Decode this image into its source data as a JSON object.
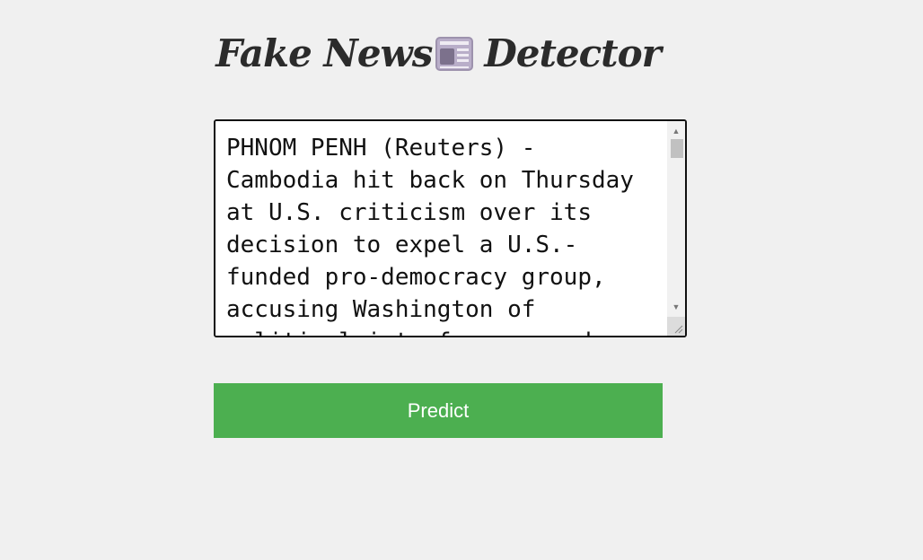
{
  "header": {
    "title_part1": "Fake News",
    "title_icon": "newspaper-icon",
    "title_part2": "Detector"
  },
  "news_input": {
    "value": "PHNOM PENH (Reuters) - Cambodia hit back on Thursday at U.S. criticism over its decision to expel a U.S.-funded pro-democracy group, accusing Washington of political interference and"
  },
  "predict_button": {
    "label": "Predict"
  },
  "colors": {
    "background": "#f0f0f0",
    "title": "#2b2b2b",
    "button": "#4caf50",
    "button_text": "#ffffff",
    "icon": "#b9aec9"
  }
}
